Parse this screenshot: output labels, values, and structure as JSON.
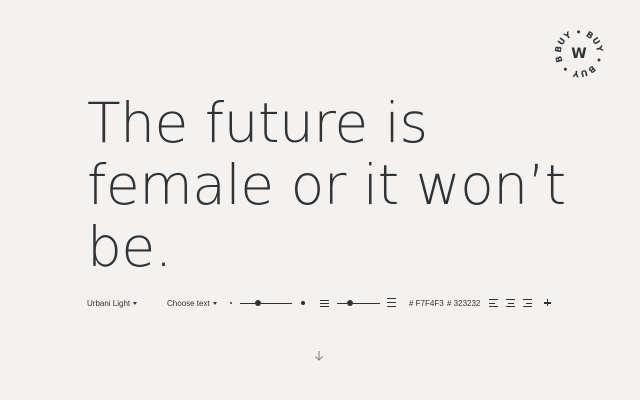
{
  "badge": {
    "ring_words": [
      "BUY",
      "BUY",
      "BUY",
      "BUY"
    ],
    "letter": "W"
  },
  "specimen": {
    "text": "The future is female or it won’t be."
  },
  "toolbar": {
    "font_select": "Urbani Light",
    "text_select": "Choose text",
    "size_slider": {
      "value_fraction": 0.35
    },
    "leading_slider": {
      "value_fraction": 0.3
    },
    "background_color": "# F7F4F3",
    "text_color": "# 323232",
    "align_options": [
      "left",
      "center",
      "right"
    ],
    "add_icon": "plus-icon"
  },
  "scroll": {
    "icon": "arrow-down-icon"
  },
  "colors": {
    "background": "#F4F2F0",
    "ink": "#323232"
  }
}
